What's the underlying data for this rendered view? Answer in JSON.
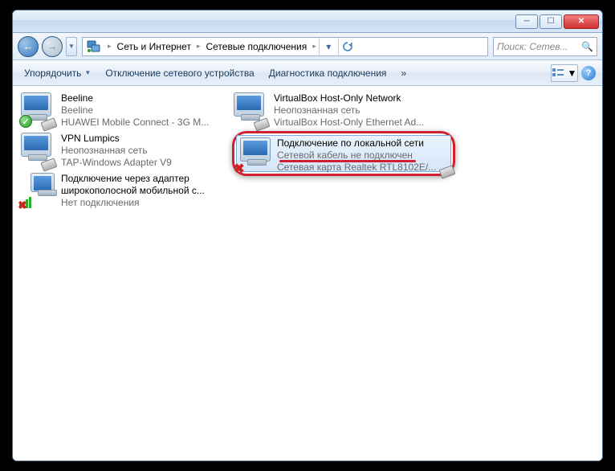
{
  "breadcrumb": {
    "part1": "Сеть и Интернет",
    "part2": "Сетевые подключения"
  },
  "search": {
    "placeholder": "Поиск: Сетев..."
  },
  "toolbar": {
    "organize": "Упорядочить",
    "disable": "Отключение сетевого устройства",
    "diagnose": "Диагностика подключения",
    "more": "»"
  },
  "items": [
    {
      "name": "Beeline",
      "line2": "Beeline",
      "line3": "HUAWEI Mobile Connect - 3G M...",
      "status": "ok"
    },
    {
      "name": "VirtualBox Host-Only Network",
      "line2": "Неопознанная сеть",
      "line3": "VirtualBox Host-Only Ethernet Ad...",
      "status": "none"
    },
    {
      "name": "VPN Lumpics",
      "line2": "Неопознанная сеть",
      "line3": "TAP-Windows Adapter V9",
      "status": "none"
    },
    {
      "name": "Подключение по локальной сети",
      "line2": "Сетевой кабель не подключен",
      "line3": "Сетевая карта Realtek RTL8102E/...",
      "status": "x"
    },
    {
      "name": "Подключение через адаптер широкополосной мобильной с...",
      "line2": "",
      "line3": "Нет подключения",
      "status": "bars-x"
    }
  ]
}
